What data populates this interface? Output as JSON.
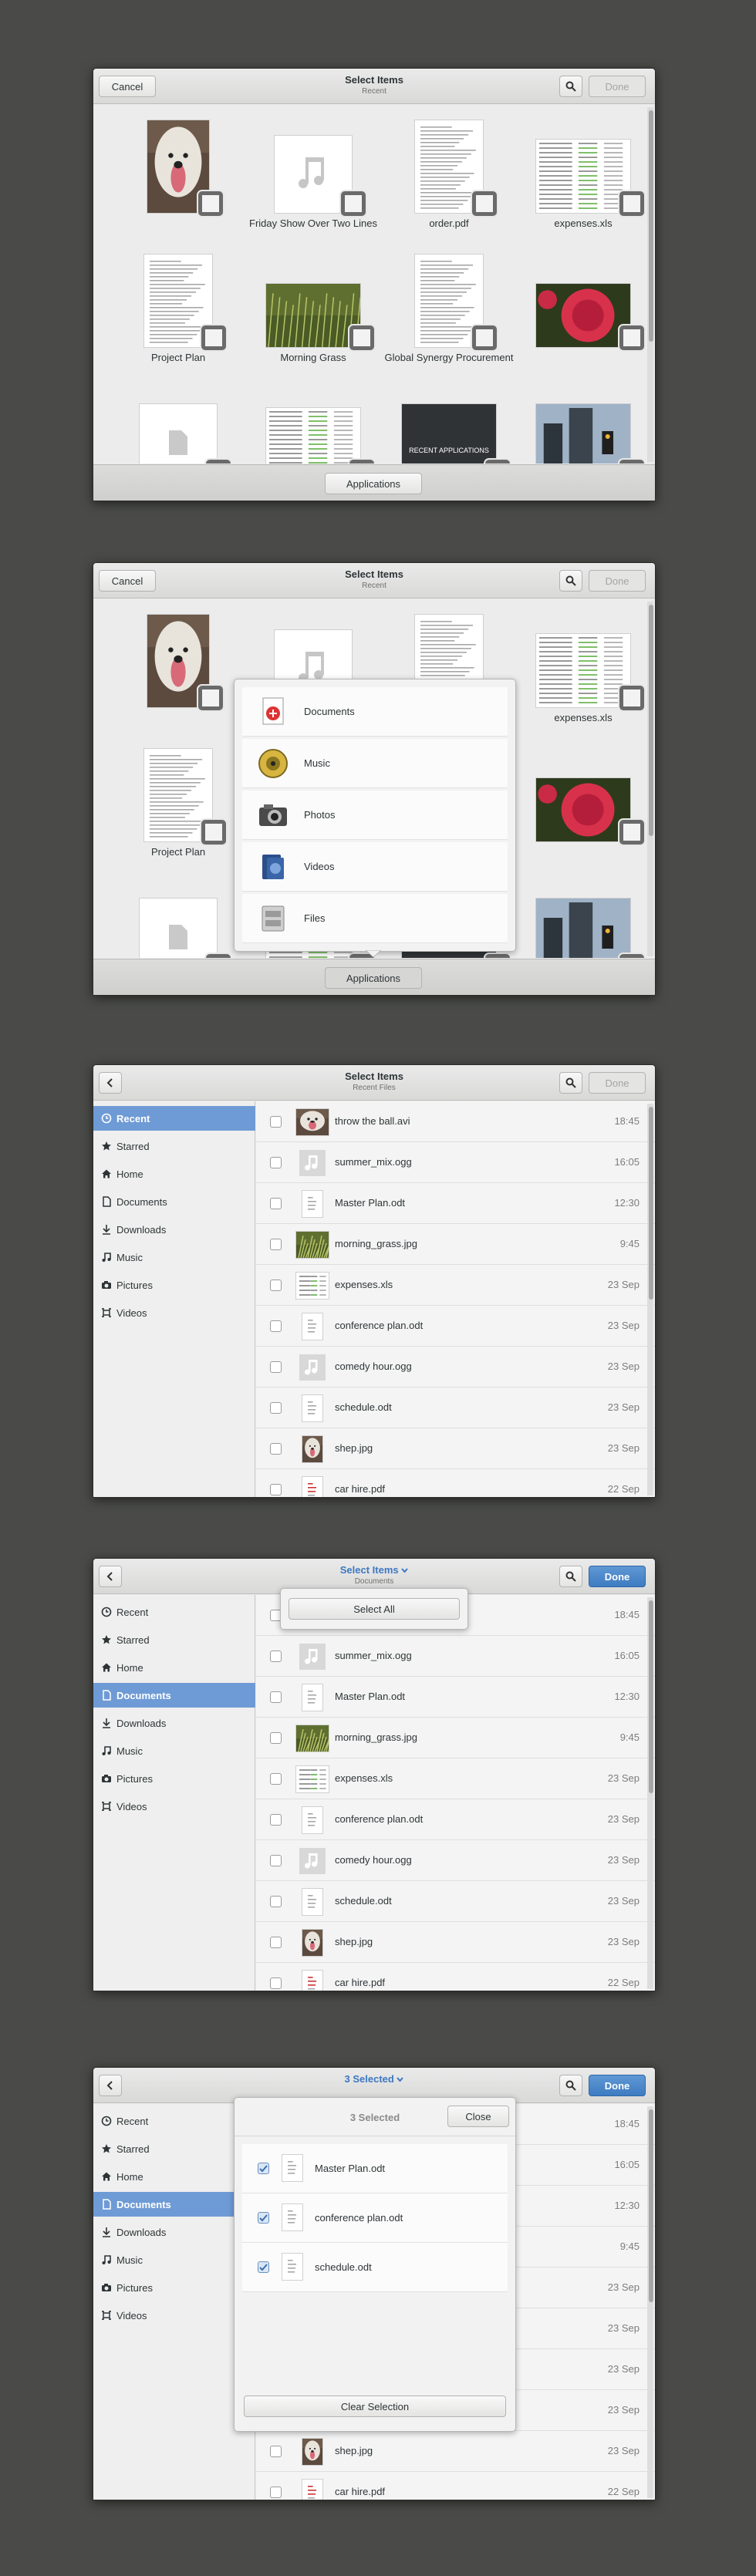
{
  "grid_header": {
    "cancel": "Cancel",
    "title": "Select Items",
    "subtitle": "Recent",
    "done": "Done"
  },
  "grid_items": [
    {
      "name": "",
      "thumb": "photo-dog"
    },
    {
      "name": "Friday Show Over Two Lines",
      "thumb": "music"
    },
    {
      "name": "order.pdf",
      "thumb": "doc"
    },
    {
      "name": "expenses.xls",
      "thumb": "sheet"
    },
    {
      "name": "Project Plan",
      "thumb": "doc"
    },
    {
      "name": "Morning Grass",
      "thumb": "photo-grass"
    },
    {
      "name": "Global Synergy Procurement",
      "thumb": "doc"
    },
    {
      "name": "",
      "thumb": "photo-flower"
    },
    {
      "name": "",
      "thumb": "file"
    },
    {
      "name": "",
      "thumb": "sheet"
    },
    {
      "name": "",
      "thumb": "dark"
    },
    {
      "name": "",
      "thumb": "photo-city"
    }
  ],
  "bottom_button": "Applications",
  "apps_menu": [
    {
      "label": "Documents",
      "icon": "documents-icon"
    },
    {
      "label": "Music",
      "icon": "music-icon"
    },
    {
      "label": "Photos",
      "icon": "photos-icon"
    },
    {
      "label": "Videos",
      "icon": "videos-icon"
    },
    {
      "label": "Files",
      "icon": "files-icon"
    }
  ],
  "dark_thumb_text": "RECENT APPLICATIONS",
  "list3_header": {
    "title": "Select Items",
    "subtitle": "Recent Files",
    "done": "Done"
  },
  "sidebar": [
    {
      "label": "Recent",
      "icon": "clock-icon"
    },
    {
      "label": "Starred",
      "icon": "star-icon"
    },
    {
      "label": "Home",
      "icon": "home-icon"
    },
    {
      "label": "Documents",
      "icon": "document-icon"
    },
    {
      "label": "Downloads",
      "icon": "download-icon"
    },
    {
      "label": "Music",
      "icon": "music-note-icon"
    },
    {
      "label": "Pictures",
      "icon": "camera-icon"
    },
    {
      "label": "Videos",
      "icon": "film-icon"
    }
  ],
  "files": [
    {
      "name": "throw the ball.avi",
      "time": "18:45",
      "thumb": "photo-dog"
    },
    {
      "name": "summer_mix.ogg",
      "time": "16:05",
      "thumb": "music"
    },
    {
      "name": "Master Plan.odt",
      "time": "12:30",
      "thumb": "doc"
    },
    {
      "name": "morning_grass.jpg",
      "time": "9:45",
      "thumb": "photo-grass"
    },
    {
      "name": "expenses.xls",
      "time": "23 Sep",
      "thumb": "sheet"
    },
    {
      "name": "conference plan.odt",
      "time": "23 Sep",
      "thumb": "doc"
    },
    {
      "name": "comedy hour.ogg",
      "time": "23 Sep",
      "thumb": "music"
    },
    {
      "name": "schedule.odt",
      "time": "23 Sep",
      "thumb": "doc"
    },
    {
      "name": "shep.jpg",
      "time": "23 Sep",
      "thumb": "photo-dog"
    },
    {
      "name": "car hire.pdf",
      "time": "22 Sep",
      "thumb": "pdf"
    }
  ],
  "list4_header": {
    "title": "Select Items",
    "subtitle": "Documents",
    "done": "Done"
  },
  "select_all": "Select All",
  "list5_header": {
    "title": "3 Selected",
    "done": "Done"
  },
  "selection_popover": {
    "title": "3 Selected",
    "close": "Close",
    "items": [
      "Master Plan.odt",
      "conference plan.odt",
      "schedule.odt"
    ],
    "clear": "Clear Selection"
  }
}
